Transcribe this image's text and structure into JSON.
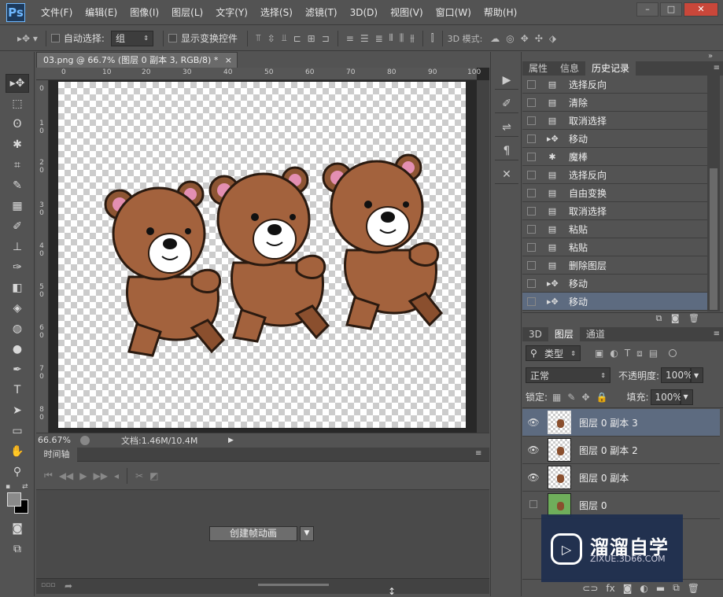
{
  "app": {
    "logo": "Ps",
    "doc_tab_title": "03.png @ 66.7% (图层 0 副本 3, RGB/8) *",
    "doc_tab_close": "×"
  },
  "menu": [
    "文件(F)",
    "编辑(E)",
    "图像(I)",
    "图层(L)",
    "文字(Y)",
    "选择(S)",
    "滤镜(T)",
    "3D(D)",
    "视图(V)",
    "窗口(W)",
    "帮助(H)"
  ],
  "window_controls": {
    "minimize": "–",
    "maximize": "□",
    "close": "✕"
  },
  "options": {
    "auto_select_label": "自动选择:",
    "auto_select_value": "组",
    "show_transform_label": "显示变换控件",
    "mode_3d_label": "3D 模式:"
  },
  "ruler": {
    "top": [
      "0",
      "10",
      "20",
      "30",
      "40",
      "50",
      "60",
      "70",
      "80",
      "90",
      "100"
    ],
    "left": [
      "0",
      "1 0",
      "2 0",
      "3 0",
      "4 0",
      "5 0",
      "6 0",
      "7 0",
      "8 0"
    ]
  },
  "status": {
    "zoom": "66.67%",
    "doc_info": "文档:1.46M/10.4M"
  },
  "timeline": {
    "tab": "时间轴",
    "create_button": "创建帧动画"
  },
  "history_panel": {
    "tabs": [
      "属性",
      "信息",
      "历史记录"
    ],
    "items": [
      {
        "label": "选择反向",
        "icon": "document-icon"
      },
      {
        "label": "清除",
        "icon": "document-icon"
      },
      {
        "label": "取消选择",
        "icon": "document-icon"
      },
      {
        "label": "移动",
        "icon": "move-icon"
      },
      {
        "label": "魔棒",
        "icon": "magic-wand-icon"
      },
      {
        "label": "选择反向",
        "icon": "document-icon"
      },
      {
        "label": "自由变换",
        "icon": "document-icon"
      },
      {
        "label": "取消选择",
        "icon": "document-icon"
      },
      {
        "label": "粘贴",
        "icon": "document-icon"
      },
      {
        "label": "粘贴",
        "icon": "document-icon"
      },
      {
        "label": "删除图层",
        "icon": "document-icon"
      },
      {
        "label": "移动",
        "icon": "move-icon"
      },
      {
        "label": "移动",
        "icon": "move-icon",
        "selected": true
      }
    ]
  },
  "layers_panel": {
    "tabs": [
      "3D",
      "图层",
      "通道"
    ],
    "filter_label": "类型",
    "blend_mode": "正常",
    "opacity_label": "不透明度:",
    "opacity_value": "100%",
    "lock_label": "锁定:",
    "fill_label": "填充:",
    "fill_value": "100%",
    "layers": [
      {
        "name": "图层 0 副本 3",
        "visible": true,
        "selected": true
      },
      {
        "name": "图层 0 副本 2",
        "visible": true,
        "selected": false
      },
      {
        "name": "图层 0 副本",
        "visible": true,
        "selected": false
      },
      {
        "name": "图层 0",
        "visible": false,
        "selected": false
      }
    ]
  },
  "watermark": {
    "title": "溜溜自学",
    "subtitle": "ZIXUE.3D66.COM"
  },
  "colors": {
    "accent_selection": "#5d6b80",
    "panel_bg": "#535353",
    "canvas_dark": "#282828"
  }
}
